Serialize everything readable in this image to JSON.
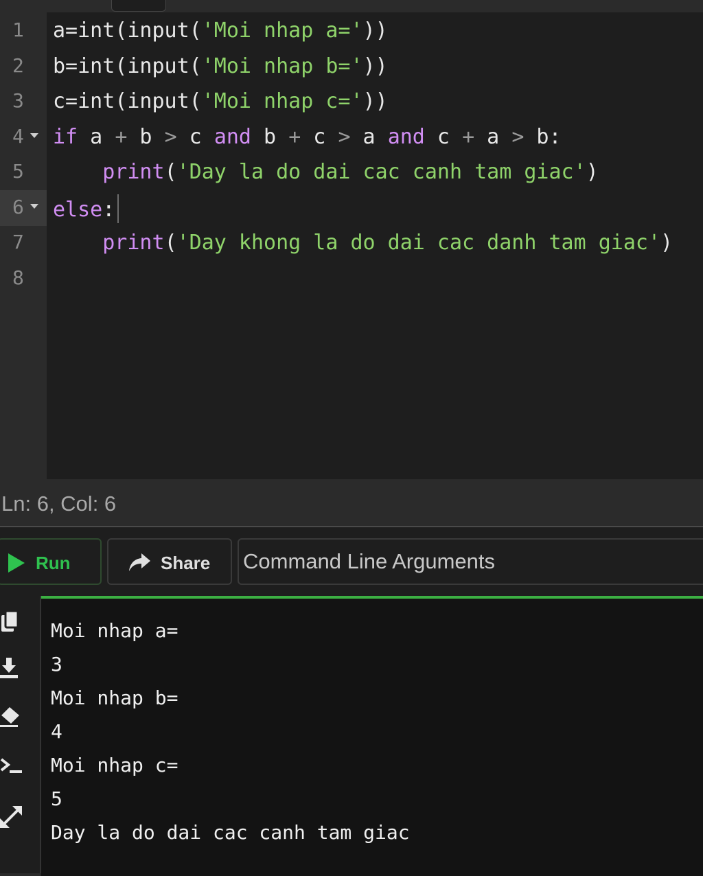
{
  "editor": {
    "lines": [
      {
        "num": "1",
        "tokens": [
          [
            "p",
            "a=int(input("
          ],
          [
            "s",
            "'Moi nhap a='"
          ],
          [
            "p",
            "))"
          ]
        ]
      },
      {
        "num": "2",
        "tokens": [
          [
            "p",
            "b=int(input("
          ],
          [
            "s",
            "'Moi nhap b='"
          ],
          [
            "p",
            "))"
          ]
        ]
      },
      {
        "num": "3",
        "tokens": [
          [
            "p",
            "c=int(input("
          ],
          [
            "s",
            "'Moi nhap c='"
          ],
          [
            "p",
            "))"
          ]
        ]
      },
      {
        "num": "4",
        "fold": true,
        "tokens": [
          [
            "k",
            "if"
          ],
          [
            "p",
            " a "
          ],
          [
            "o",
            "+"
          ],
          [
            "p",
            " b "
          ],
          [
            "o",
            ">"
          ],
          [
            "p",
            " c "
          ],
          [
            "k",
            "and"
          ],
          [
            "p",
            " b "
          ],
          [
            "o",
            "+"
          ],
          [
            "p",
            " c "
          ],
          [
            "o",
            ">"
          ],
          [
            "p",
            " a "
          ],
          [
            "k",
            "and"
          ],
          [
            "p",
            " c "
          ],
          [
            "o",
            "+"
          ],
          [
            "p",
            " a "
          ],
          [
            "o",
            ">"
          ],
          [
            "p",
            " b:"
          ]
        ]
      },
      {
        "num": "5",
        "tokens": [
          [
            "p",
            "    "
          ],
          [
            "f",
            "print"
          ],
          [
            "p",
            "("
          ],
          [
            "s",
            "'Day la do dai cac canh tam giac'"
          ],
          [
            "p",
            ")"
          ]
        ]
      },
      {
        "num": "6",
        "fold": true,
        "active": true,
        "tokens": [
          [
            "k",
            "else"
          ],
          [
            "p",
            ":"
          ],
          [
            "c",
            ""
          ]
        ]
      },
      {
        "num": "7",
        "tokens": [
          [
            "p",
            "    "
          ],
          [
            "f",
            "print"
          ],
          [
            "p",
            "("
          ],
          [
            "s",
            "'Day khong la do dai cac danh tam giac'"
          ],
          [
            "p",
            ")"
          ]
        ]
      },
      {
        "num": "8",
        "tokens": []
      }
    ]
  },
  "status": {
    "text": "Ln: 6,  Col: 6"
  },
  "toolbar": {
    "run_label": "Run",
    "share_label": "Share",
    "cli_placeholder": "Command Line Arguments"
  },
  "colors": {
    "accent_green": "#2fc24f",
    "keyword": "#d18ef3",
    "string": "#8fd36a"
  },
  "icons": [
    "copy-icon",
    "download-icon",
    "eraser-icon",
    "terminal-icon",
    "expand-icon"
  ],
  "output": {
    "lines": [
      "Moi nhap a=",
      "3",
      "Moi nhap b=",
      "4",
      "Moi nhap c=",
      "5",
      "Day la do dai cac canh tam giac"
    ]
  }
}
